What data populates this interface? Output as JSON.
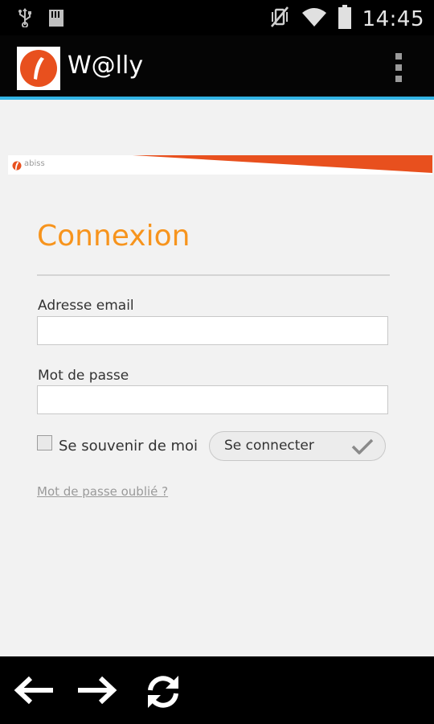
{
  "status_bar": {
    "time": "14:45",
    "icons": [
      "usb-icon",
      "sd-card-icon",
      "vibrate-off-icon",
      "wifi-icon",
      "battery-icon"
    ]
  },
  "action_bar": {
    "app_title": "W@lly",
    "logo_icon": "wally-logo-icon",
    "menu_icon": "overflow-menu-icon"
  },
  "banner": {
    "brand_text": "abiss",
    "accent_color": "#e8501e"
  },
  "login": {
    "title": "Connexion",
    "title_color": "#f7941d",
    "email_label": "Adresse email",
    "email_value": "",
    "password_label": "Mot de passe",
    "password_value": "",
    "remember_label": "Se souvenir de moi",
    "remember_checked": false,
    "submit_label": "Se connecter",
    "forgot_link": "Mot de passe oublié ?"
  },
  "nav_bar": {
    "icons": [
      "back-arrow-icon",
      "forward-arrow-icon",
      "refresh-icon"
    ]
  },
  "colors": {
    "action_bar_underline": "#33b5e5",
    "background": "#f2f2f2"
  }
}
